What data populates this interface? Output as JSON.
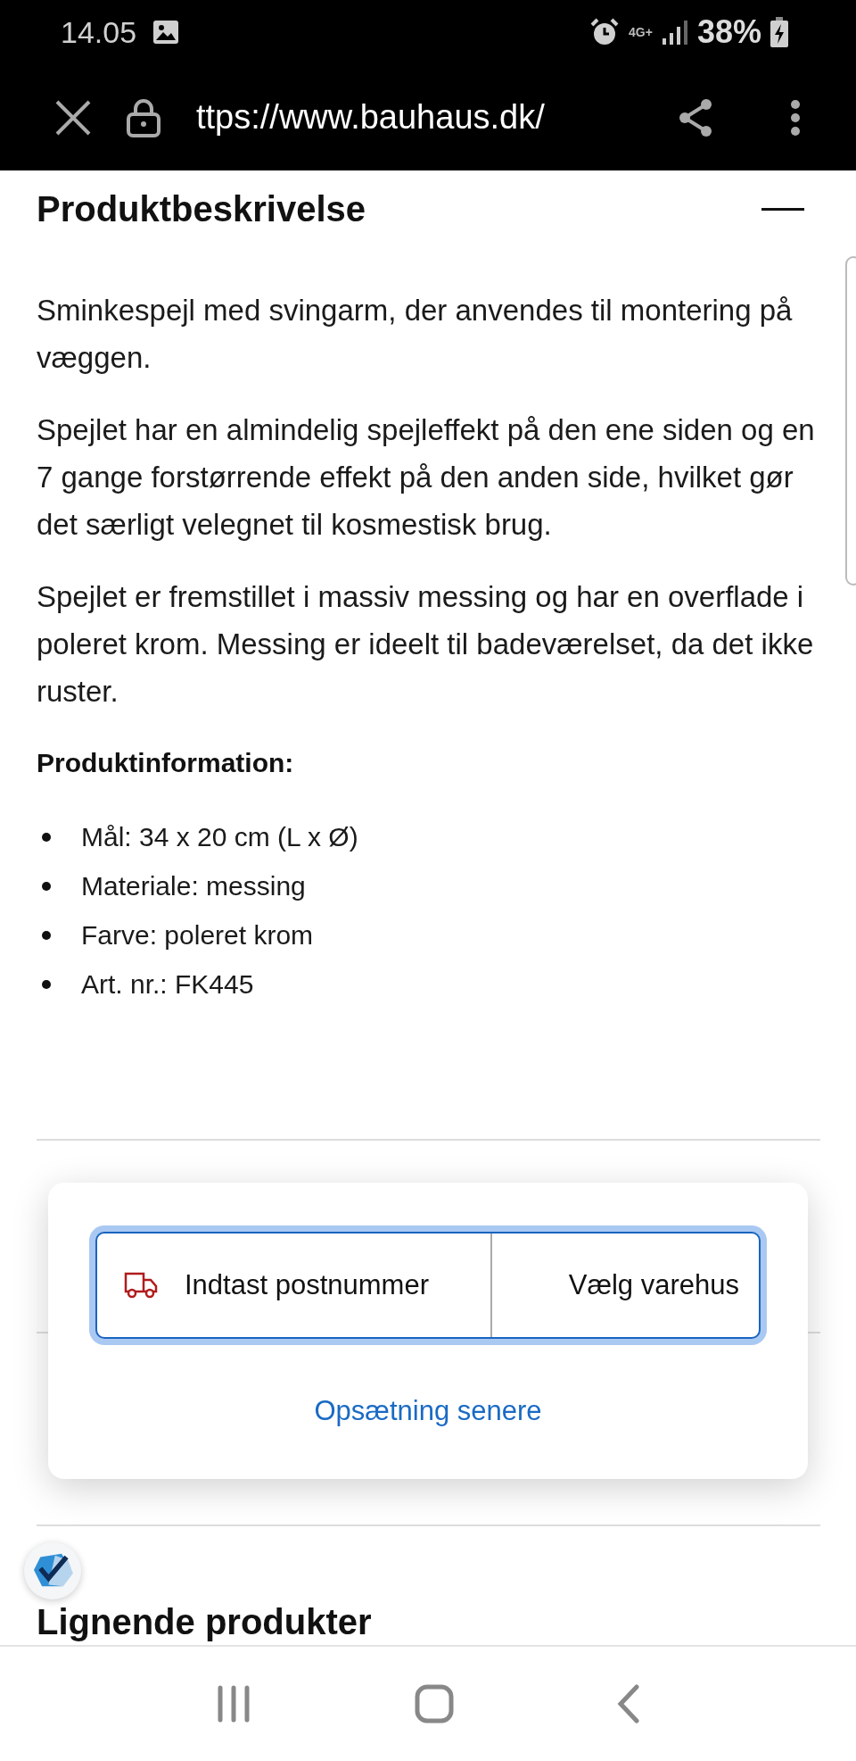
{
  "status_bar": {
    "time": "14.05",
    "network": "4G+",
    "battery": "38%"
  },
  "browser_bar": {
    "url": "ttps://www.bauhaus.dk/"
  },
  "product_description": {
    "title": "Produktbeskrivelse",
    "expanded": true,
    "paragraphs": [
      "Sminkespejl med svingarm, der anvendes til montering på væggen.",
      "Spejlet har en almindelig spejleffekt på den ene siden og en 7 gange forstørrende effekt på den anden side, hvilket gør det særligt velegnet til kosmestisk brug.",
      "Spejlet er fremstillet i massiv messing og har en overflade i poleret krom. Messing er ideelt til badeværelset, da det ikke ruster."
    ],
    "info_title": "Produktinformation:",
    "specs": [
      "Mål: 34 x 20 cm (L x Ø)",
      "Materiale: messing",
      "Farve: poleret krom",
      "Art. nr.: FK445"
    ]
  },
  "related_section": {
    "title": "Lignende produkter"
  },
  "location_popup": {
    "postcode_button": "Indtast postnummer",
    "store_button": "Vælg varehus",
    "later_link": "Opsætning senere"
  }
}
